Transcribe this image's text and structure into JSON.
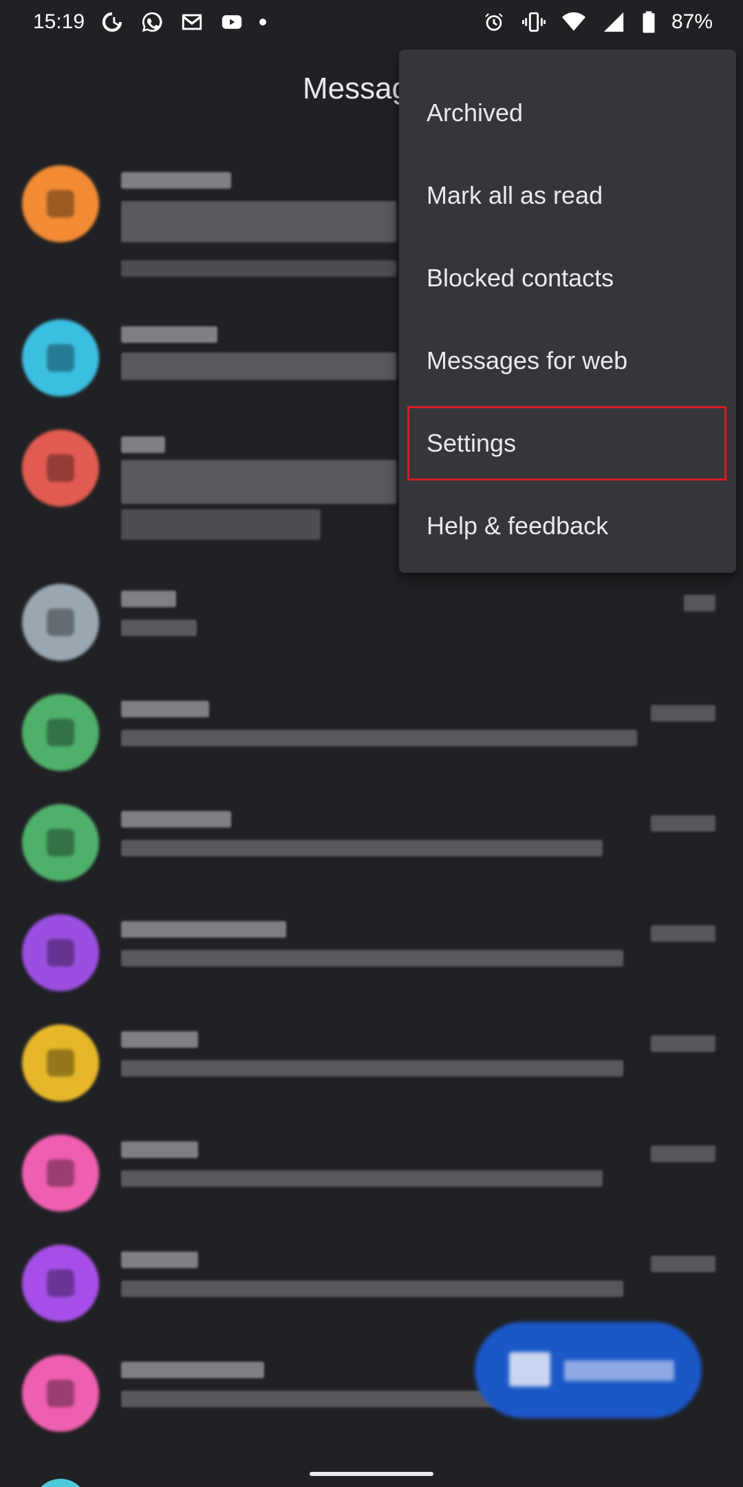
{
  "status_bar": {
    "time": "15:19",
    "battery": "87%",
    "icons": [
      "data-saver-icon",
      "whatsapp-icon",
      "gmail-icon",
      "youtube-icon",
      "notification-dot-icon",
      "alarm-icon",
      "vibrate-icon",
      "wifi-icon",
      "signal-icon",
      "battery-icon"
    ]
  },
  "app_bar": {
    "title": "Messag"
  },
  "overflow_menu": {
    "items": [
      {
        "label": "Archived"
      },
      {
        "label": "Mark all as read"
      },
      {
        "label": "Blocked contacts"
      },
      {
        "label": "Messages for web"
      },
      {
        "label": "Settings"
      },
      {
        "label": "Help & feedback"
      }
    ]
  },
  "conversations": {
    "avatar_colors": [
      "#f28b34",
      "#3bbfe0",
      "#e25b52",
      "#9aa7b0",
      "#4fb06b",
      "#4fb06b",
      "#9b4fe0",
      "#e6b829",
      "#ef5fb0",
      "#a64fe8",
      "#ef5fb0"
    ]
  },
  "theme": {
    "background": "#202124",
    "menu_background": "#35363a",
    "highlight_border": "#d41e24",
    "fab_color": "#1a57c7"
  }
}
